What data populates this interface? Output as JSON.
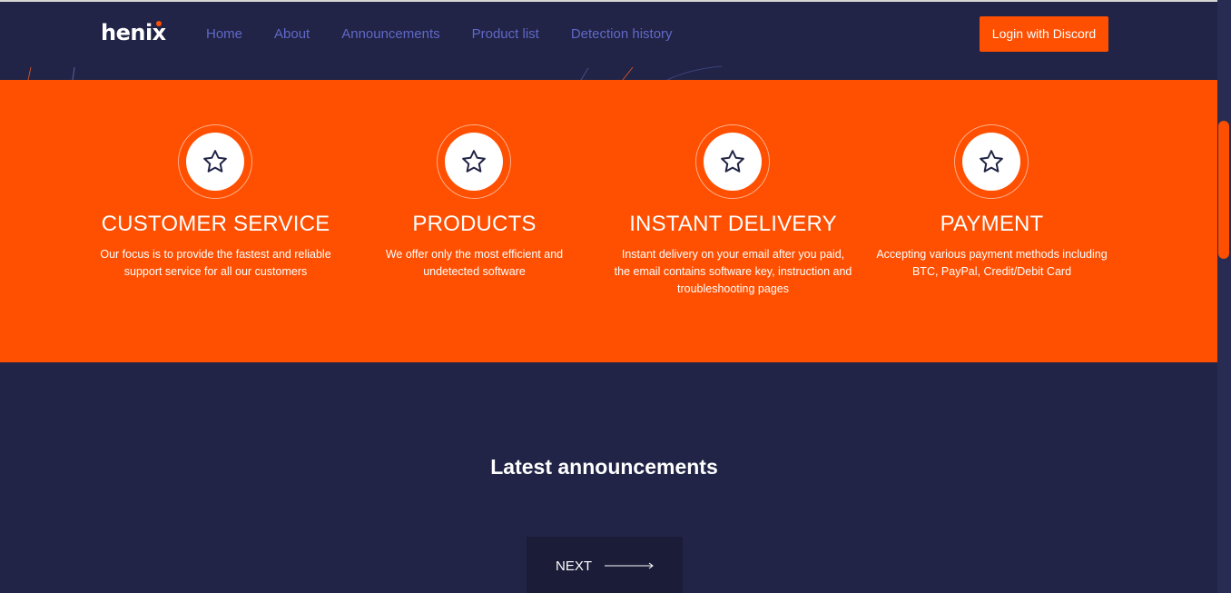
{
  "header": {
    "logo": "henix",
    "nav": [
      "Home",
      "About",
      "Announcements",
      "Product list",
      "Detection history"
    ],
    "login_label": "Login with Discord"
  },
  "features": [
    {
      "icon": "star-icon",
      "title": "CUSTOMER SERVICE",
      "lines": [
        "Our focus is to provide the fastest and reliable",
        "support service for all our customers"
      ]
    },
    {
      "icon": "star-icon",
      "title": "PRODUCTS",
      "lines": [
        "We offer only the most efficient and",
        "undetected software"
      ]
    },
    {
      "icon": "star-icon",
      "title": "INSTANT DELIVERY",
      "lines": [
        "Instant delivery on your email after you paid,",
        "the email contains software key, instruction and",
        "troubleshooting pages"
      ]
    },
    {
      "icon": "star-icon",
      "title": "PAYMENT",
      "lines": [
        "Accepting various payment methods including",
        "BTC, PayPal, Credit/Debit Card"
      ]
    }
  ],
  "announcements": {
    "title": "Latest announcements",
    "next_label": "NEXT"
  },
  "colors": {
    "accent": "#ff4f00",
    "background": "#212446",
    "nav_link": "#6068c8"
  }
}
